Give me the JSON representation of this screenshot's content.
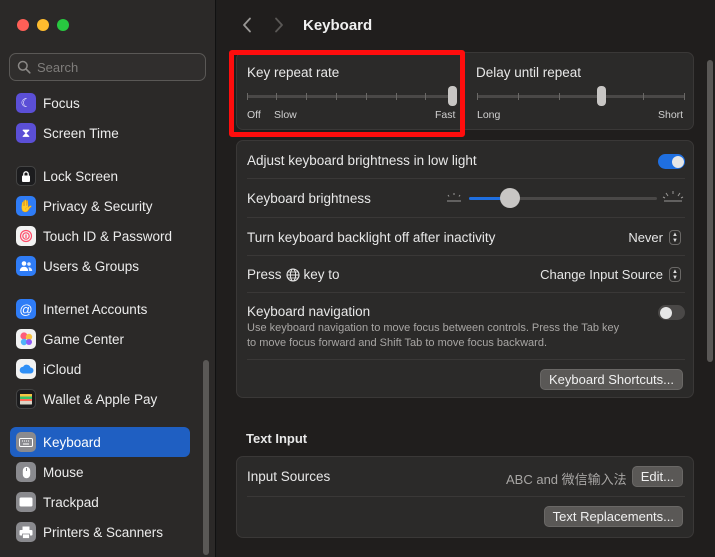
{
  "colors": {
    "accent": "#1f6fe0",
    "highlight": "#ff0d0d",
    "sidebar_active": "#1f5fc2"
  },
  "search": {
    "placeholder": "Search"
  },
  "sidebar": {
    "items": [
      {
        "label": "Focus",
        "icon": "moon-icon",
        "color": "#5b4fd6"
      },
      {
        "label": "Screen Time",
        "icon": "hourglass-icon",
        "color": "#5b4fd6"
      },
      {
        "label": "Lock Screen",
        "icon": "lock-icon",
        "color": "#1c1c1e"
      },
      {
        "label": "Privacy & Security",
        "icon": "hand-icon",
        "color": "#2f7cf6"
      },
      {
        "label": "Touch ID & Password",
        "icon": "fingerprint-icon",
        "color": "#f2f2f2"
      },
      {
        "label": "Users & Groups",
        "icon": "users-icon",
        "color": "#2f7cf6"
      },
      {
        "label": "Internet Accounts",
        "icon": "at-icon",
        "color": "#2f7cf6"
      },
      {
        "label": "Game Center",
        "icon": "game-center-icon",
        "color": "#f2f2f2"
      },
      {
        "label": "iCloud",
        "icon": "cloud-icon",
        "color": "#f2f2f2"
      },
      {
        "label": "Wallet & Apple Pay",
        "icon": "wallet-icon",
        "color": "#1c1c1e"
      },
      {
        "label": "Keyboard",
        "icon": "keyboard-icon",
        "color": "#8a8a8e"
      },
      {
        "label": "Mouse",
        "icon": "mouse-icon",
        "color": "#8a8a8e"
      },
      {
        "label": "Trackpad",
        "icon": "trackpad-icon",
        "color": "#8a8a8e"
      },
      {
        "label": "Printers & Scanners",
        "icon": "printer-icon",
        "color": "#8a8a8e"
      }
    ],
    "selected": "Keyboard"
  },
  "header": {
    "title": "Keyboard"
  },
  "key_repeat": {
    "label": "Key repeat rate",
    "left_labels": [
      "Off",
      "Slow"
    ],
    "right_label": "Fast",
    "value_fraction": 1.0
  },
  "delay_repeat": {
    "label": "Delay until repeat",
    "left_label": "Long",
    "right_label": "Short",
    "value_fraction": 0.6
  },
  "settings": {
    "adjust_brightness": {
      "label": "Adjust keyboard brightness in low light",
      "enabled": true
    },
    "brightness": {
      "label": "Keyboard brightness",
      "value_fraction": 0.2
    },
    "backlight_off": {
      "label": "Turn keyboard backlight off after inactivity",
      "value": "Never"
    },
    "press_key": {
      "label_before": "Press",
      "label_after": "key to",
      "value": "Change Input Source"
    },
    "navigation": {
      "label": "Keyboard navigation",
      "description_line1": "Use keyboard navigation to move focus between controls. Press the Tab key",
      "description_line2": "to move focus forward and Shift Tab to move focus backward.",
      "enabled": false
    },
    "shortcuts_button": "Keyboard Shortcuts..."
  },
  "text_input": {
    "section_title": "Text Input",
    "input_sources_label": "Input Sources",
    "input_sources_value": "ABC and 微信输入法",
    "edit_button": "Edit...",
    "replacements_button": "Text Replacements..."
  }
}
